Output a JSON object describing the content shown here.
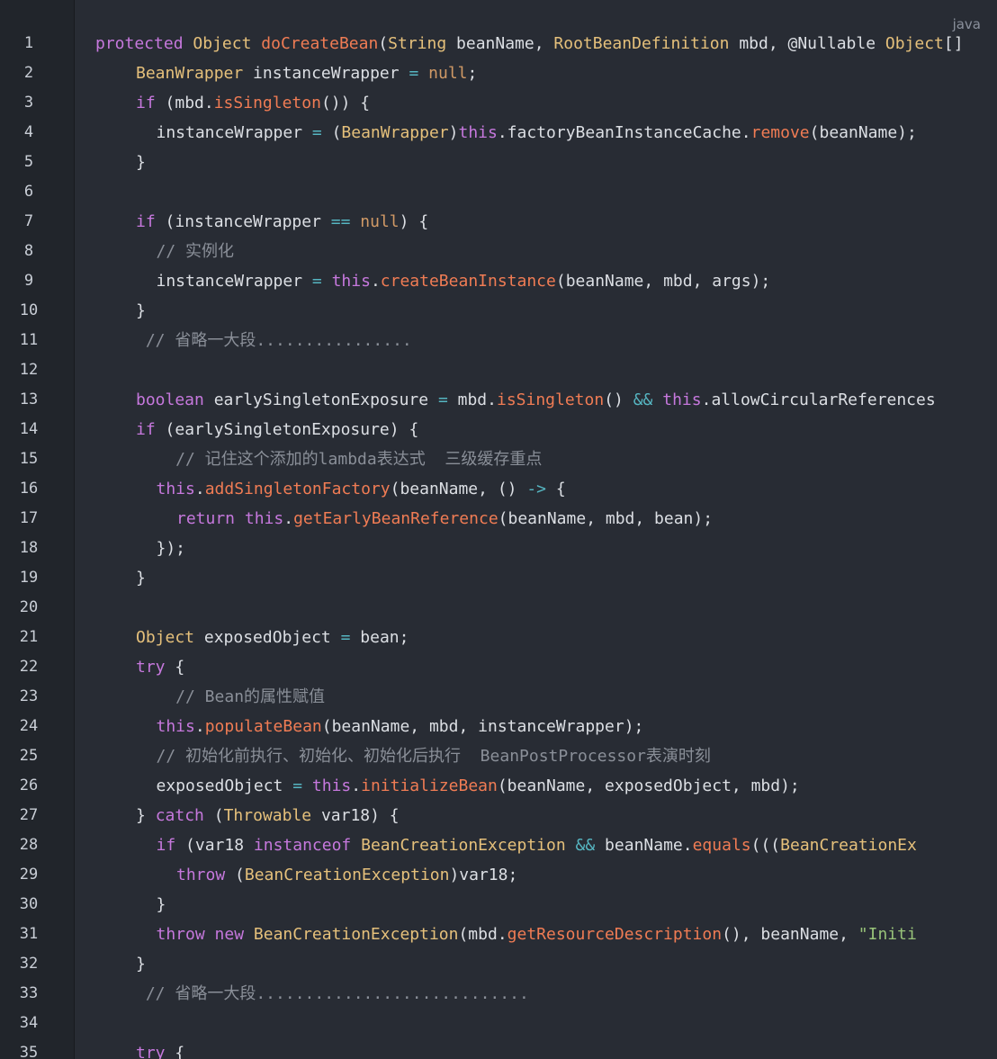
{
  "language_badge": "java",
  "colors": {
    "background": "#282c34",
    "gutter": "#21252b",
    "keyword": "#c678dd",
    "type": "#e5c07b",
    "function": "#f07c54",
    "operator": "#56b6c2",
    "literal": "#d19a66",
    "string": "#98c379",
    "comment": "#8a8f98",
    "text": "#dcdfe4"
  },
  "lines": [
    {
      "n": "1",
      "indent": 0,
      "tokens": [
        [
          "kw",
          "protected"
        ],
        [
          "tx",
          " "
        ],
        [
          "ty",
          "Object"
        ],
        [
          "tx",
          " "
        ],
        [
          "fn",
          "doCreateBean"
        ],
        [
          "tx",
          "("
        ],
        [
          "ty",
          "String"
        ],
        [
          "tx",
          " beanName, "
        ],
        [
          "ty",
          "RootBeanDefinition"
        ],
        [
          "tx",
          " mbd, @Nullable "
        ],
        [
          "ty",
          "Object"
        ],
        [
          "tx",
          "[]"
        ]
      ]
    },
    {
      "n": "2",
      "indent": 4,
      "tokens": [
        [
          "ty",
          "BeanWrapper"
        ],
        [
          "tx",
          " instanceWrapper "
        ],
        [
          "op",
          "="
        ],
        [
          "tx",
          " "
        ],
        [
          "num",
          "null"
        ],
        [
          "tx",
          ";"
        ]
      ]
    },
    {
      "n": "3",
      "indent": 4,
      "tokens": [
        [
          "kw",
          "if"
        ],
        [
          "tx",
          " (mbd."
        ],
        [
          "fn",
          "isSingleton"
        ],
        [
          "tx",
          "()) {"
        ]
      ]
    },
    {
      "n": "4",
      "indent": 6,
      "tokens": [
        [
          "tx",
          "instanceWrapper "
        ],
        [
          "op",
          "="
        ],
        [
          "tx",
          " ("
        ],
        [
          "ty",
          "BeanWrapper"
        ],
        [
          "tx",
          ")"
        ],
        [
          "kw",
          "this"
        ],
        [
          "tx",
          ".factoryBeanInstanceCache."
        ],
        [
          "fn",
          "remove"
        ],
        [
          "tx",
          "(beanName);"
        ]
      ]
    },
    {
      "n": "5",
      "indent": 4,
      "tokens": [
        [
          "tx",
          "}"
        ]
      ]
    },
    {
      "n": "6",
      "indent": 0,
      "tokens": []
    },
    {
      "n": "7",
      "indent": 4,
      "tokens": [
        [
          "kw",
          "if"
        ],
        [
          "tx",
          " (instanceWrapper "
        ],
        [
          "op",
          "=="
        ],
        [
          "tx",
          " "
        ],
        [
          "num",
          "null"
        ],
        [
          "tx",
          ") {"
        ]
      ]
    },
    {
      "n": "8",
      "indent": 6,
      "tokens": [
        [
          "cm",
          "// 实例化"
        ]
      ]
    },
    {
      "n": "9",
      "indent": 6,
      "tokens": [
        [
          "tx",
          "instanceWrapper "
        ],
        [
          "op",
          "="
        ],
        [
          "tx",
          " "
        ],
        [
          "kw",
          "this"
        ],
        [
          "tx",
          "."
        ],
        [
          "fn",
          "createBeanInstance"
        ],
        [
          "tx",
          "(beanName, mbd, args);"
        ]
      ]
    },
    {
      "n": "10",
      "indent": 4,
      "tokens": [
        [
          "tx",
          "}"
        ]
      ]
    },
    {
      "n": "11",
      "indent": 4,
      "tokens": [
        [
          "cm",
          " // 省略一大段................"
        ]
      ]
    },
    {
      "n": "12",
      "indent": 0,
      "tokens": []
    },
    {
      "n": "13",
      "indent": 4,
      "tokens": [
        [
          "kw",
          "boolean"
        ],
        [
          "tx",
          " earlySingletonExposure "
        ],
        [
          "op",
          "="
        ],
        [
          "tx",
          " mbd."
        ],
        [
          "fn",
          "isSingleton"
        ],
        [
          "tx",
          "() "
        ],
        [
          "op",
          "&&"
        ],
        [
          "tx",
          " "
        ],
        [
          "kw",
          "this"
        ],
        [
          "tx",
          ".allowCircularReferences"
        ]
      ]
    },
    {
      "n": "14",
      "indent": 4,
      "tokens": [
        [
          "kw",
          "if"
        ],
        [
          "tx",
          " (earlySingletonExposure) {"
        ]
      ]
    },
    {
      "n": "15",
      "indent": 6,
      "tokens": [
        [
          "cm",
          "  // 记住这个添加的lambda表达式  三级缓存重点"
        ]
      ]
    },
    {
      "n": "16",
      "indent": 6,
      "tokens": [
        [
          "kw",
          "this"
        ],
        [
          "tx",
          "."
        ],
        [
          "fn",
          "addSingletonFactory"
        ],
        [
          "tx",
          "(beanName, () "
        ],
        [
          "op",
          "->"
        ],
        [
          "tx",
          " {"
        ]
      ]
    },
    {
      "n": "17",
      "indent": 8,
      "tokens": [
        [
          "kw",
          "return"
        ],
        [
          "tx",
          " "
        ],
        [
          "kw",
          "this"
        ],
        [
          "tx",
          "."
        ],
        [
          "fn",
          "getEarlyBeanReference"
        ],
        [
          "tx",
          "(beanName, mbd, bean);"
        ]
      ]
    },
    {
      "n": "18",
      "indent": 6,
      "tokens": [
        [
          "tx",
          "});"
        ]
      ]
    },
    {
      "n": "19",
      "indent": 4,
      "tokens": [
        [
          "tx",
          "}"
        ]
      ]
    },
    {
      "n": "20",
      "indent": 0,
      "tokens": []
    },
    {
      "n": "21",
      "indent": 4,
      "tokens": [
        [
          "ty",
          "Object"
        ],
        [
          "tx",
          " exposedObject "
        ],
        [
          "op",
          "="
        ],
        [
          "tx",
          " bean;"
        ]
      ]
    },
    {
      "n": "22",
      "indent": 4,
      "tokens": [
        [
          "kw",
          "try"
        ],
        [
          "tx",
          " {"
        ]
      ]
    },
    {
      "n": "23",
      "indent": 6,
      "tokens": [
        [
          "cm",
          "  // Bean的属性赋值"
        ]
      ]
    },
    {
      "n": "24",
      "indent": 6,
      "tokens": [
        [
          "kw",
          "this"
        ],
        [
          "tx",
          "."
        ],
        [
          "fn",
          "populateBean"
        ],
        [
          "tx",
          "(beanName, mbd, instanceWrapper);"
        ]
      ]
    },
    {
      "n": "25",
      "indent": 6,
      "tokens": [
        [
          "cm",
          "// 初始化前执行、初始化、初始化后执行  BeanPostProcessor表演时刻"
        ]
      ]
    },
    {
      "n": "26",
      "indent": 6,
      "tokens": [
        [
          "tx",
          "exposedObject "
        ],
        [
          "op",
          "="
        ],
        [
          "tx",
          " "
        ],
        [
          "kw",
          "this"
        ],
        [
          "tx",
          "."
        ],
        [
          "fn",
          "initializeBean"
        ],
        [
          "tx",
          "(beanName, exposedObject, mbd);"
        ]
      ]
    },
    {
      "n": "27",
      "indent": 4,
      "tokens": [
        [
          "tx",
          "} "
        ],
        [
          "kw",
          "catch"
        ],
        [
          "tx",
          " ("
        ],
        [
          "ty",
          "Throwable"
        ],
        [
          "tx",
          " var18) {"
        ]
      ]
    },
    {
      "n": "28",
      "indent": 6,
      "tokens": [
        [
          "kw",
          "if"
        ],
        [
          "tx",
          " (var18 "
        ],
        [
          "kw",
          "instanceof"
        ],
        [
          "tx",
          " "
        ],
        [
          "ty",
          "BeanCreationException"
        ],
        [
          "tx",
          " "
        ],
        [
          "op",
          "&&"
        ],
        [
          "tx",
          " beanName."
        ],
        [
          "fn",
          "equals"
        ],
        [
          "tx",
          "((("
        ],
        [
          "ty",
          "BeanCreationEx"
        ]
      ]
    },
    {
      "n": "29",
      "indent": 8,
      "tokens": [
        [
          "kw",
          "throw"
        ],
        [
          "tx",
          " ("
        ],
        [
          "ty",
          "BeanCreationException"
        ],
        [
          "tx",
          ")var18;"
        ]
      ]
    },
    {
      "n": "30",
      "indent": 6,
      "tokens": [
        [
          "tx",
          "}"
        ]
      ]
    },
    {
      "n": "31",
      "indent": 6,
      "tokens": [
        [
          "kw",
          "throw"
        ],
        [
          "tx",
          " "
        ],
        [
          "kw",
          "new"
        ],
        [
          "tx",
          " "
        ],
        [
          "ty",
          "BeanCreationException"
        ],
        [
          "tx",
          "(mbd."
        ],
        [
          "fn",
          "getResourceDescription"
        ],
        [
          "tx",
          "(), beanName, "
        ],
        [
          "str",
          "\"Initi"
        ]
      ]
    },
    {
      "n": "32",
      "indent": 4,
      "tokens": [
        [
          "tx",
          "}"
        ]
      ]
    },
    {
      "n": "33",
      "indent": 4,
      "tokens": [
        [
          "cm",
          " // 省略一大段............................"
        ]
      ]
    },
    {
      "n": "34",
      "indent": 0,
      "tokens": []
    },
    {
      "n": "35",
      "indent": 4,
      "tokens": [
        [
          "kw",
          "try"
        ],
        [
          "tx",
          " {"
        ]
      ]
    }
  ]
}
